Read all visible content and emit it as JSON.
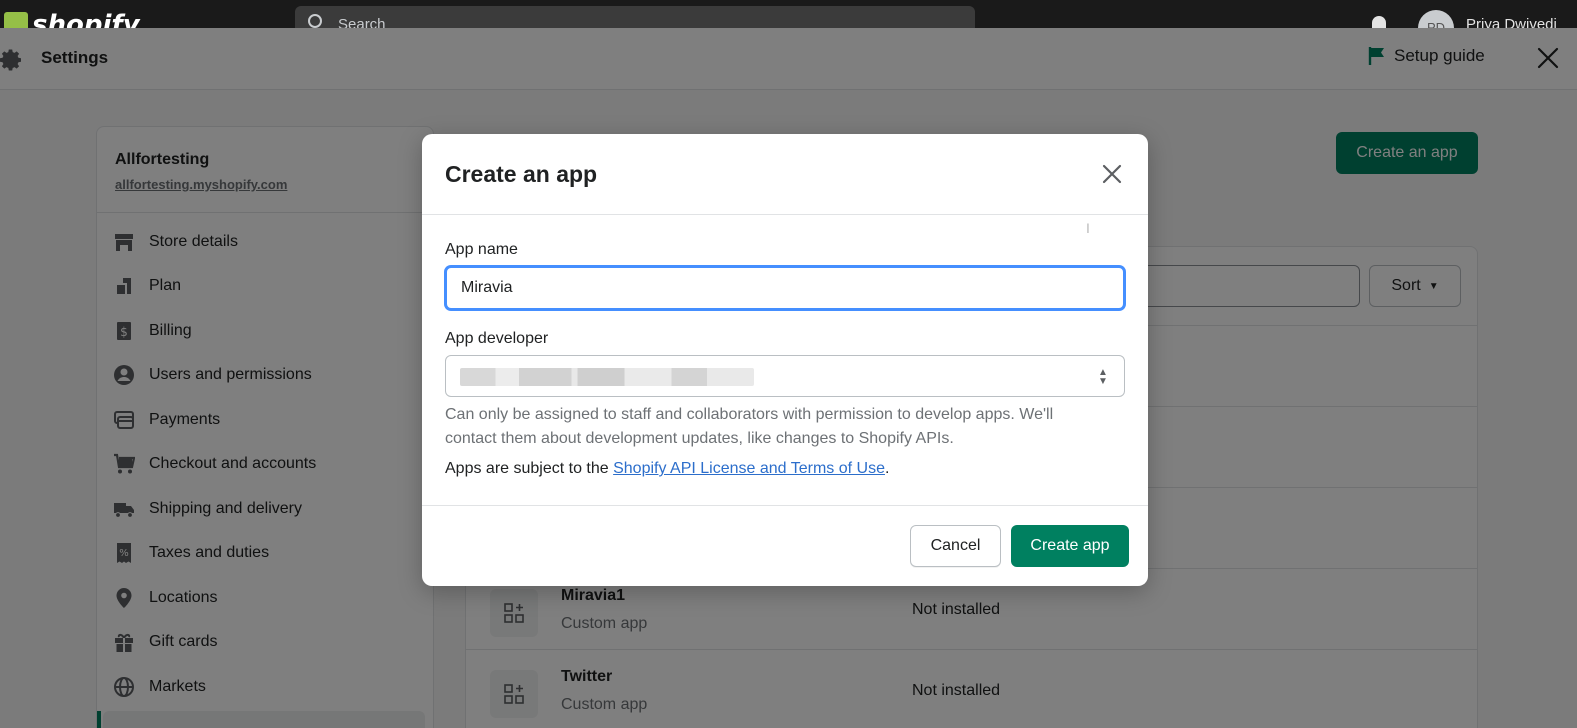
{
  "topbar": {
    "logo": "shopify",
    "search_placeholder": "Search",
    "user_initials": "PD",
    "user_name": "Priya Dwivedi"
  },
  "settings_header": {
    "title": "Settings",
    "setup_guide": "Setup guide"
  },
  "sidebar": {
    "store_name": "Allfortesting",
    "store_url": "allfortesting.myshopify.com",
    "items": [
      {
        "label": "Store details",
        "icon": "store-icon"
      },
      {
        "label": "Plan",
        "icon": "plan-icon"
      },
      {
        "label": "Billing",
        "icon": "billing-icon"
      },
      {
        "label": "Users and permissions",
        "icon": "user-icon"
      },
      {
        "label": "Payments",
        "icon": "payments-icon"
      },
      {
        "label": "Checkout and accounts",
        "icon": "cart-icon"
      },
      {
        "label": "Shipping and delivery",
        "icon": "truck-icon"
      },
      {
        "label": "Taxes and duties",
        "icon": "tax-icon"
      },
      {
        "label": "Locations",
        "icon": "location-icon"
      },
      {
        "label": "Gift cards",
        "icon": "gift-icon"
      },
      {
        "label": "Markets",
        "icon": "globe-icon"
      }
    ]
  },
  "content": {
    "create_button": "Create an app",
    "sort_label": "Sort",
    "apps": [
      {
        "name": "Miravia1",
        "type": "Custom app",
        "status": "Not installed"
      },
      {
        "name": "Twitter",
        "type": "Custom app",
        "status": "Not installed"
      }
    ]
  },
  "modal": {
    "title": "Create an app",
    "app_name_label": "App name",
    "app_name_value": "Miravia",
    "app_developer_label": "App developer",
    "help_text": "Can only be assigned to staff and collaborators with permission to develop apps. We'll contact them about development updates, like changes to Shopify APIs.",
    "terms_prefix": "Apps are subject to the ",
    "terms_link": "Shopify API License and Terms of Use",
    "terms_suffix": ".",
    "cancel_label": "Cancel",
    "create_label": "Create app"
  },
  "colors": {
    "primary": "#008060",
    "link": "#2c6ecb",
    "focus": "#458fff"
  }
}
